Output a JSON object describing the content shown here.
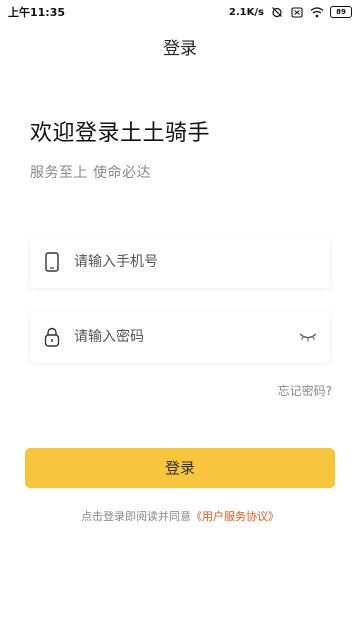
{
  "status_bar": {
    "time": "上午11:35",
    "net_speed": "2.1K/s",
    "battery": "89",
    "icons": [
      "alarm-off-icon",
      "sim-off-icon",
      "wifi-icon",
      "battery-icon"
    ]
  },
  "header": {
    "title": "登录"
  },
  "welcome": {
    "heading": "欢迎登录土土骑手",
    "slogan": "服务至上  使命必达"
  },
  "form": {
    "phone_placeholder": "请输入手机号",
    "password_placeholder": "请输入密码",
    "forgot_label": "忘记密码?",
    "login_label": "登录"
  },
  "agreement": {
    "prefix": "点击登录即阅读并同意",
    "link": "《用户服务协议》"
  },
  "colors": {
    "accent": "#f8c53f",
    "link": "#e05a2a",
    "muted_text": "#888888"
  }
}
